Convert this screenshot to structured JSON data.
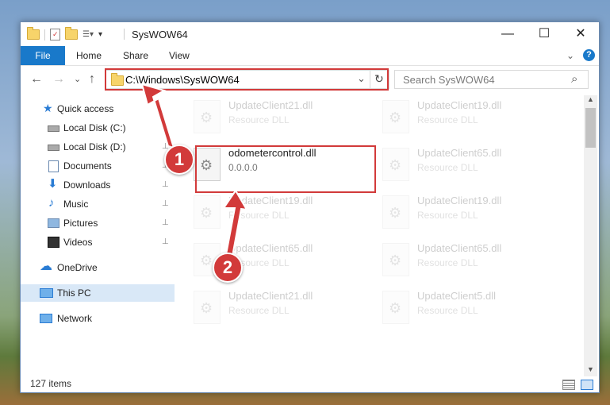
{
  "window": {
    "title": "SysWOW64",
    "controls": {
      "minimize": "—",
      "maximize": "☐",
      "close": "✕"
    }
  },
  "ribbon": {
    "tabs": [
      "File",
      "Home",
      "Share",
      "View"
    ],
    "expand_glyph": "⌄",
    "help_glyph": "?"
  },
  "nav": {
    "back": "←",
    "forward": "→",
    "recent": "⌄",
    "up": "↑",
    "address": "C:\\Windows\\SysWOW64",
    "dropdown": "⌄",
    "refresh": "↻",
    "search_placeholder": "Search SysWOW64",
    "search_glyph": "⌕"
  },
  "sidebar": {
    "items": [
      {
        "label": "Quick access",
        "icon": "star-icon",
        "pinned": false
      },
      {
        "label": "Local Disk (C:)",
        "icon": "drive-icon",
        "pinned": true
      },
      {
        "label": "Local Disk (D:)",
        "icon": "drive-icon",
        "pinned": true
      },
      {
        "label": "Documents",
        "icon": "documents-icon",
        "pinned": true
      },
      {
        "label": "Downloads",
        "icon": "downloads-icon",
        "pinned": true
      },
      {
        "label": "Music",
        "icon": "music-icon",
        "pinned": true
      },
      {
        "label": "Pictures",
        "icon": "pictures-icon",
        "pinned": true
      },
      {
        "label": "Videos",
        "icon": "videos-icon",
        "pinned": true
      },
      {
        "label": "OneDrive",
        "icon": "cloud-icon",
        "pinned": false
      },
      {
        "label": "This PC",
        "icon": "computer-icon",
        "pinned": false,
        "selected": true
      },
      {
        "label": "Network",
        "icon": "network-icon",
        "pinned": false
      }
    ],
    "pin_glyph": "📌"
  },
  "files": {
    "left": [
      {
        "name": "UpdateClient21.dll",
        "desc": "Resource DLL"
      },
      {
        "name": "odometercontrol.dll",
        "desc": "0.0.0.0",
        "highlighted": true
      },
      {
        "name": "UpdateClient19.dll",
        "desc": "Resource DLL"
      },
      {
        "name": "UpdateClient65.dll",
        "desc": "Resource DLL"
      },
      {
        "name": "UpdateClient21.dll",
        "desc": "Resource DLL"
      }
    ],
    "right": [
      {
        "name": "UpdateClient19.dll",
        "desc": "Resource DLL"
      },
      {
        "name": "UpdateClient65.dll",
        "desc": "Resource DLL"
      },
      {
        "name": "UpdateClient19.dll",
        "desc": "Resource DLL"
      },
      {
        "name": "UpdateClient65.dll",
        "desc": "Resource DLL"
      },
      {
        "name": "UpdateClient5.dll",
        "desc": "Resource DLL"
      }
    ]
  },
  "status": {
    "items_count": "127 items"
  },
  "callouts": [
    "1",
    "2"
  ],
  "colors": {
    "accent": "#1979ca",
    "highlight": "#d23a3a",
    "selected": "#d9e8f7"
  }
}
